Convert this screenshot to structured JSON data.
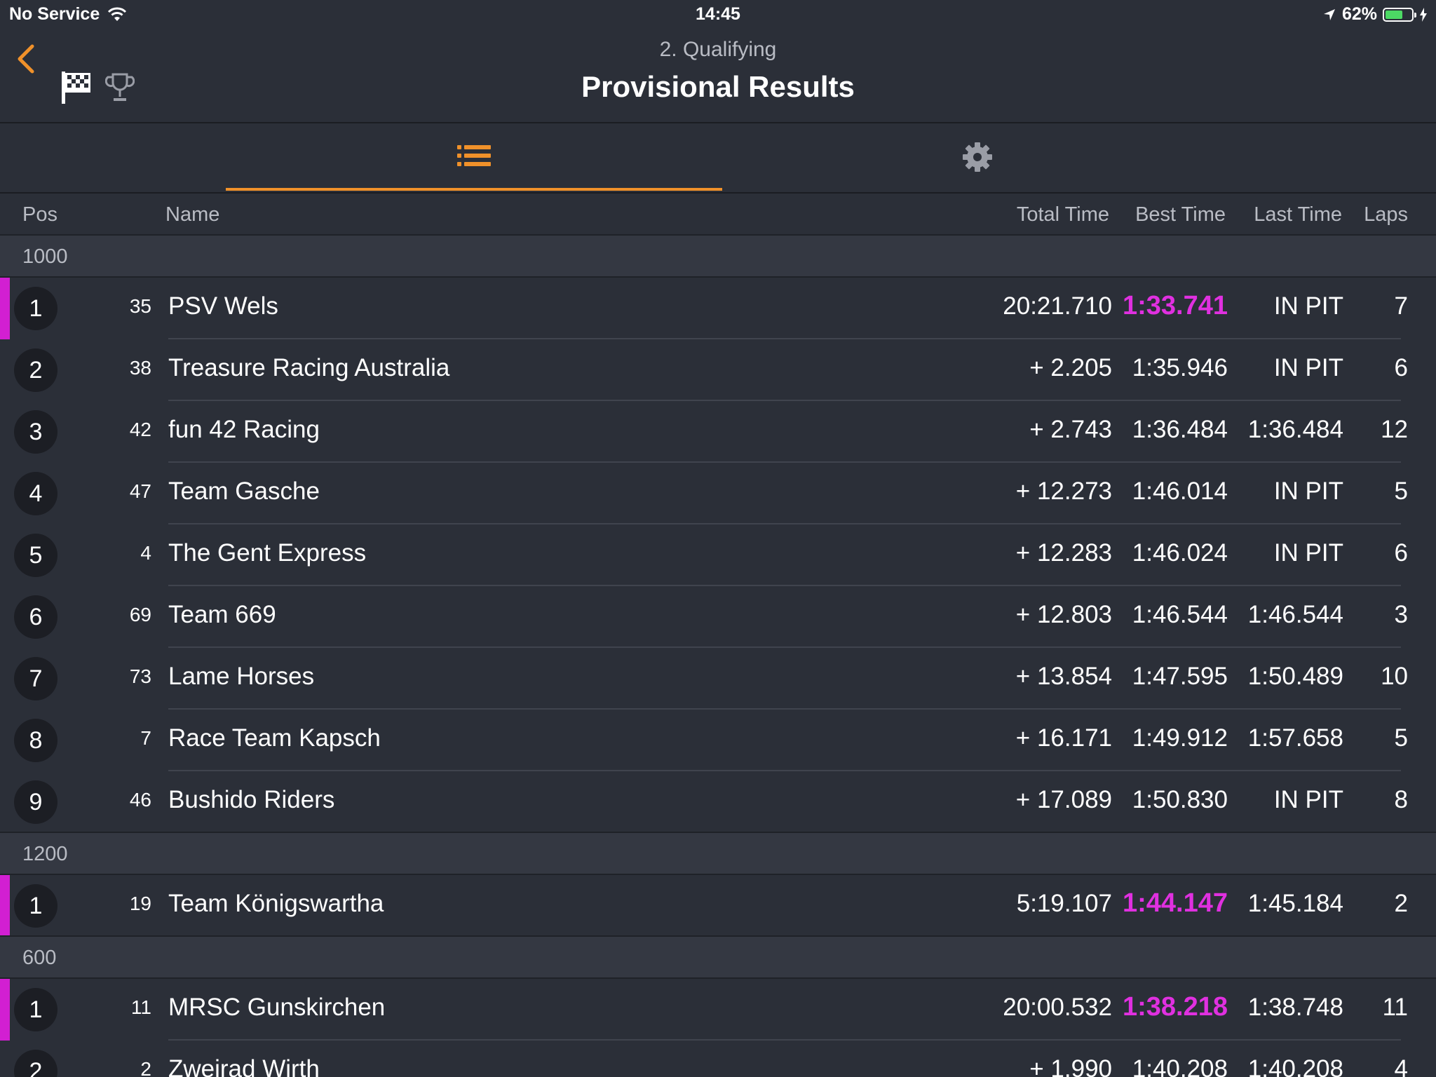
{
  "status_bar": {
    "carrier": "No Service",
    "time": "14:45",
    "battery": "62%"
  },
  "header": {
    "subtitle": "2. Qualifying",
    "title": "Provisional Results"
  },
  "tabs": [
    {
      "icon": "list-icon",
      "active": true
    },
    {
      "icon": "gear-icon",
      "active": false
    }
  ],
  "columns": {
    "pos": "Pos",
    "name": "Name",
    "total": "Total Time",
    "best": "Best Time",
    "last": "Last Time",
    "laps": "Laps"
  },
  "colors": {
    "accent": "#f0912a",
    "best_lap": "#e030e0",
    "background": "#2b2f38"
  },
  "groups": [
    {
      "label": "1000",
      "rows": [
        {
          "pos": "1",
          "num": "35",
          "name": "PSV Wels",
          "total": "20:21.710",
          "best": "1:33.741",
          "best_highlight": true,
          "last": "IN PIT",
          "laps": "7"
        },
        {
          "pos": "2",
          "num": "38",
          "name": "Treasure Racing Australia",
          "total": "+ 2.205",
          "best": "1:35.946",
          "best_highlight": false,
          "last": "IN PIT",
          "laps": "6"
        },
        {
          "pos": "3",
          "num": "42",
          "name": "fun 42 Racing",
          "total": "+ 2.743",
          "best": "1:36.484",
          "best_highlight": false,
          "last": "1:36.484",
          "laps": "12"
        },
        {
          "pos": "4",
          "num": "47",
          "name": "Team Gasche",
          "total": "+ 12.273",
          "best": "1:46.014",
          "best_highlight": false,
          "last": "IN PIT",
          "laps": "5"
        },
        {
          "pos": "5",
          "num": "4",
          "name": "The Gent Express",
          "total": "+ 12.283",
          "best": "1:46.024",
          "best_highlight": false,
          "last": "IN PIT",
          "laps": "6"
        },
        {
          "pos": "6",
          "num": "69",
          "name": "Team 669",
          "total": "+ 12.803",
          "best": "1:46.544",
          "best_highlight": false,
          "last": "1:46.544",
          "laps": "3"
        },
        {
          "pos": "7",
          "num": "73",
          "name": "Lame Horses",
          "total": "+ 13.854",
          "best": "1:47.595",
          "best_highlight": false,
          "last": "1:50.489",
          "laps": "10"
        },
        {
          "pos": "8",
          "num": "7",
          "name": "Race Team Kapsch",
          "total": "+ 16.171",
          "best": "1:49.912",
          "best_highlight": false,
          "last": "1:57.658",
          "laps": "5"
        },
        {
          "pos": "9",
          "num": "46",
          "name": "Bushido Riders",
          "total": "+ 17.089",
          "best": "1:50.830",
          "best_highlight": false,
          "last": "IN PIT",
          "laps": "8"
        }
      ]
    },
    {
      "label": "1200",
      "rows": [
        {
          "pos": "1",
          "num": "19",
          "name": "Team Königswartha",
          "total": "5:19.107",
          "best": "1:44.147",
          "best_highlight": true,
          "last": "1:45.184",
          "laps": "2"
        }
      ]
    },
    {
      "label": "600",
      "rows": [
        {
          "pos": "1",
          "num": "11",
          "name": "MRSC Gunskirchen",
          "total": "20:00.532",
          "best": "1:38.218",
          "best_highlight": true,
          "last": "1:38.748",
          "laps": "11"
        },
        {
          "pos": "2",
          "num": "2",
          "name": "Zweirad Wirth",
          "total": "+ 1.990",
          "best": "1:40.208",
          "best_highlight": false,
          "last": "1:40.208",
          "laps": "4"
        }
      ]
    }
  ]
}
